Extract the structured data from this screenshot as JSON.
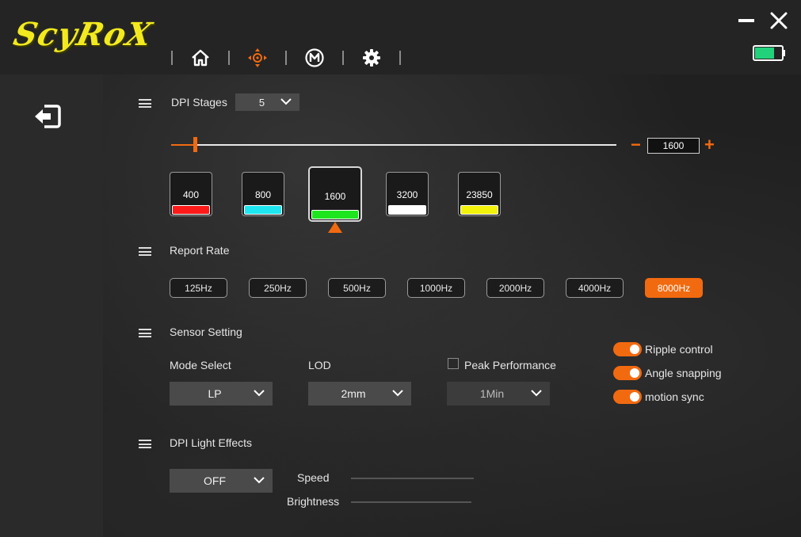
{
  "app": {
    "logo_text": "ScyRoX"
  },
  "nav": {
    "items": [
      {
        "name": "home",
        "icon": "home-icon"
      },
      {
        "name": "dpi",
        "icon": "crosshair-move-icon"
      },
      {
        "name": "macro",
        "icon": "macro-m-icon"
      },
      {
        "name": "settings",
        "icon": "gear-icon"
      }
    ],
    "active_index": 1
  },
  "battery": {
    "level": 0.75,
    "color": "#22d27a"
  },
  "dpi": {
    "section_label": "DPI Stages",
    "stage_count": "5",
    "current_value": "1600",
    "minus_label": "−",
    "plus_label": "+",
    "slider_fraction": 0.05,
    "stages": [
      {
        "value": "400",
        "color": "#ff1a1a"
      },
      {
        "value": "800",
        "color": "#1ee6f0"
      },
      {
        "value": "1600",
        "color": "#1ee61e",
        "active": true
      },
      {
        "value": "3200",
        "color": "#ffffff"
      },
      {
        "value": "23850",
        "color": "#f2f20a"
      }
    ]
  },
  "report_rate": {
    "section_label": "Report Rate",
    "options": [
      "125Hz",
      "250Hz",
      "500Hz",
      "1000Hz",
      "2000Hz",
      "4000Hz",
      "8000Hz"
    ],
    "selected": "8000Hz"
  },
  "sensor": {
    "section_label": "Sensor Setting",
    "mode_label": "Mode Select",
    "mode_value": "LP",
    "lod_label": "LOD",
    "lod_value": "2mm",
    "peak_label": "Peak Performance",
    "peak_checked": false,
    "peak_value": "1Min",
    "toggles": [
      {
        "label": "Ripple control",
        "on": true
      },
      {
        "label": "Angle snapping",
        "on": true
      },
      {
        "label": "motion sync",
        "on": true
      }
    ]
  },
  "light": {
    "section_label": "DPI Light Effects",
    "effect_value": "OFF",
    "speed_label": "Speed",
    "brightness_label": "Brightness"
  },
  "colors": {
    "accent": "#f26a10",
    "logo": "#f2ea1f"
  }
}
